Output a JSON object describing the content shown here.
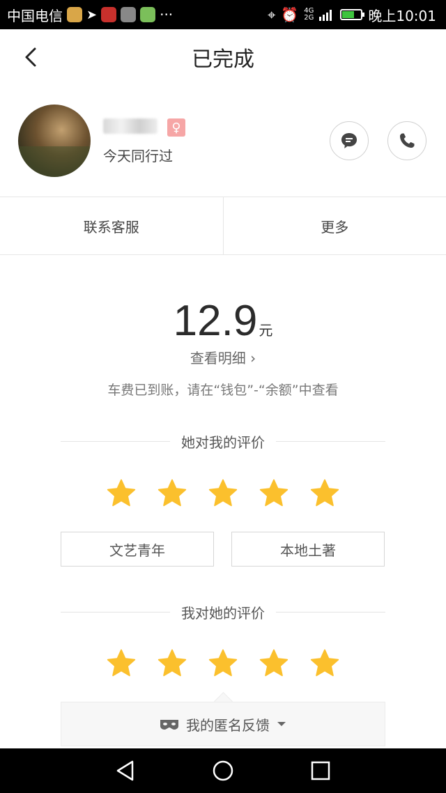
{
  "status_bar": {
    "carrier": "中国电信",
    "more": "···",
    "net_top": "4G",
    "net_bottom": "2G",
    "time": "晚上10:01"
  },
  "header": {
    "title": "已完成"
  },
  "profile": {
    "subtitle": "今天同行过",
    "gender_symbol": "♀"
  },
  "actions": {
    "support": "联系客服",
    "more": "更多"
  },
  "fare": {
    "amount": "12.9",
    "unit": "元",
    "detail_link": "查看明细 ›",
    "note": "车费已到账，请在“钱包”-“余额”中查看"
  },
  "rating_from_her": {
    "heading": "她对我的评价",
    "stars": 5,
    "tags": [
      "文艺青年",
      "本地土著"
    ]
  },
  "rating_by_me": {
    "heading": "我对她的评价",
    "stars": 5
  },
  "feedback": {
    "label": "我的匿名反馈"
  },
  "colors": {
    "star": "#fbc02d",
    "badge": "#f6a6a6"
  }
}
